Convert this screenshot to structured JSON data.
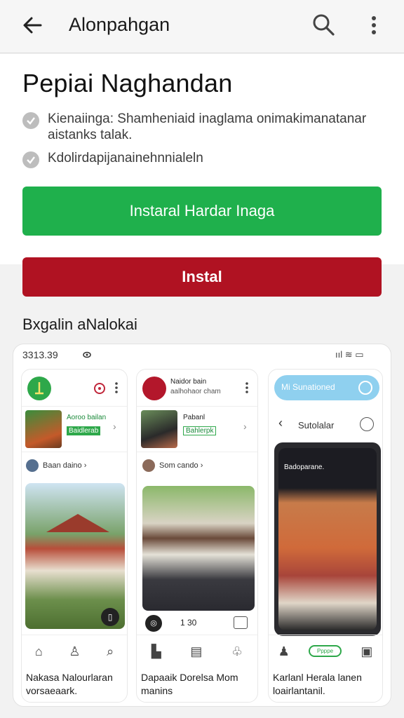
{
  "appbar": {
    "title": "Alonpahgan"
  },
  "main": {
    "heading": "Pepiai Naghandan",
    "features": [
      "Kienaiinga: Shamheniaid inaglama onimakimanatanar aistanks talak.",
      "Kdolirdapijanainehnnialeln"
    ],
    "primary_button": "Instaral Hardar Inaga",
    "install_button": "Instal",
    "section_title": "Bxgalin aNalokai"
  },
  "preview": {
    "status_time": "3313.39",
    "status_icons": "ııl ≋ ▭",
    "cards": [
      {
        "item_title": "Aoroo bailan",
        "item_badge": "Baidlerab",
        "user_row": "Baan daino ›",
        "caption": "Nakasa Nalourlaran vorsaeaark."
      },
      {
        "header_title": "Naidor bain",
        "header_sub": "aalhohaor cham",
        "item_title": "Pabanl",
        "item_badge": "Bahlerpk",
        "user_row": "Som cando ›",
        "counter": "1 30",
        "caption": "Dapaaik Dorelsa Mom manins"
      },
      {
        "chip_label": "Mi Sunationed",
        "sub_header": "Sutolalar",
        "video_title": "Badoparane.",
        "nav_pill": "Ppppe",
        "caption": "Karlanl Herala lanen loairlantanil."
      }
    ]
  },
  "colors": {
    "primary_green": "#1fb04c",
    "install_red": "#b01222",
    "chip_blue": "#8fd0ef"
  }
}
